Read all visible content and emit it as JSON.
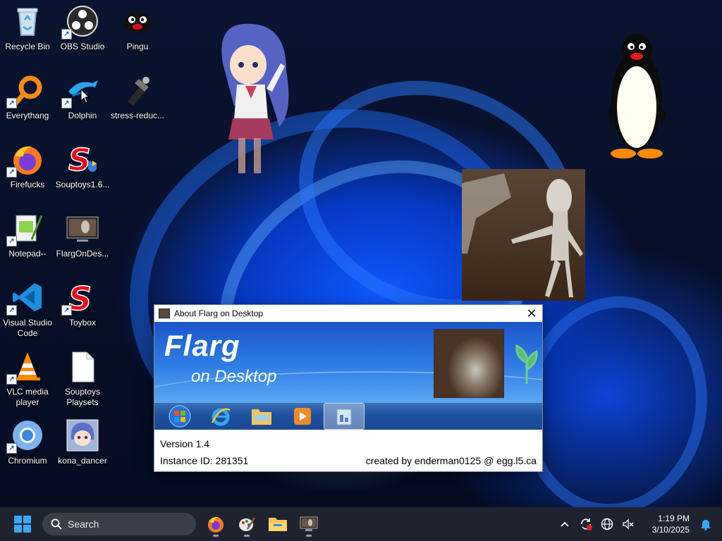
{
  "desktop_icons": [
    {
      "label": "Recycle Bin",
      "icon": "recycle-bin-icon",
      "shortcut": false
    },
    {
      "label": "OBS Studio",
      "icon": "obs-studio-icon",
      "shortcut": true
    },
    {
      "label": "Pingu",
      "icon": "pingu-icon",
      "shortcut": false
    },
    {
      "label": "Everythang",
      "icon": "everything-search-icon",
      "shortcut": true
    },
    {
      "label": "Dolphin",
      "icon": "dolphin-icon",
      "shortcut": true
    },
    {
      "label": "stress-reduc...",
      "icon": "stress-reducer-icon",
      "shortcut": false
    },
    {
      "label": "Firefucks",
      "icon": "firefox-icon",
      "shortcut": true
    },
    {
      "label": "Souptoys1.6...",
      "icon": "souptoys-icon",
      "shortcut": false
    },
    {
      "label": "Notepad--",
      "icon": "notepad-icon",
      "shortcut": true
    },
    {
      "label": "FlargOnDes...",
      "icon": "flarg-on-desktop-icon",
      "shortcut": false
    },
    {
      "label": "Visual Studio Code",
      "icon": "vscode-icon",
      "shortcut": true
    },
    {
      "label": "Toybox",
      "icon": "toybox-icon",
      "shortcut": true
    },
    {
      "label": "VLC media player",
      "icon": "vlc-icon",
      "shortcut": true
    },
    {
      "label": "Souptoys Playsets",
      "icon": "blank-file-icon",
      "shortcut": false
    },
    {
      "label": "Chromium",
      "icon": "chromium-icon",
      "shortcut": true
    },
    {
      "label": "kona_dancer",
      "icon": "kona-dancer-icon",
      "shortcut": false
    }
  ],
  "about_dialog": {
    "title": "About Flarg on Desktop",
    "close_glyph": "✕",
    "banner_title": "Flarg",
    "banner_subtitle": "on Desktop",
    "version": "Version 1.4",
    "instance_id": "Instance ID: 281351",
    "credit": "created by enderman0125 @ egg.l5.ca"
  },
  "taskbar": {
    "search_placeholder": "Search",
    "pinned_apps": [
      "firefox-icon",
      "paint-icon",
      "file-explorer-icon",
      "flarg-on-desktop-icon"
    ],
    "tray_icons": [
      "chevron-up-icon",
      "sync-alert-icon",
      "globe-icon",
      "volume-muted-icon"
    ],
    "time": "1:19 PM",
    "date": "3/10/2025",
    "notification_icon": "bell-icon"
  },
  "colors": {
    "taskbar_bg": "#1f2330",
    "accent_blue": "#0f58ff"
  }
}
